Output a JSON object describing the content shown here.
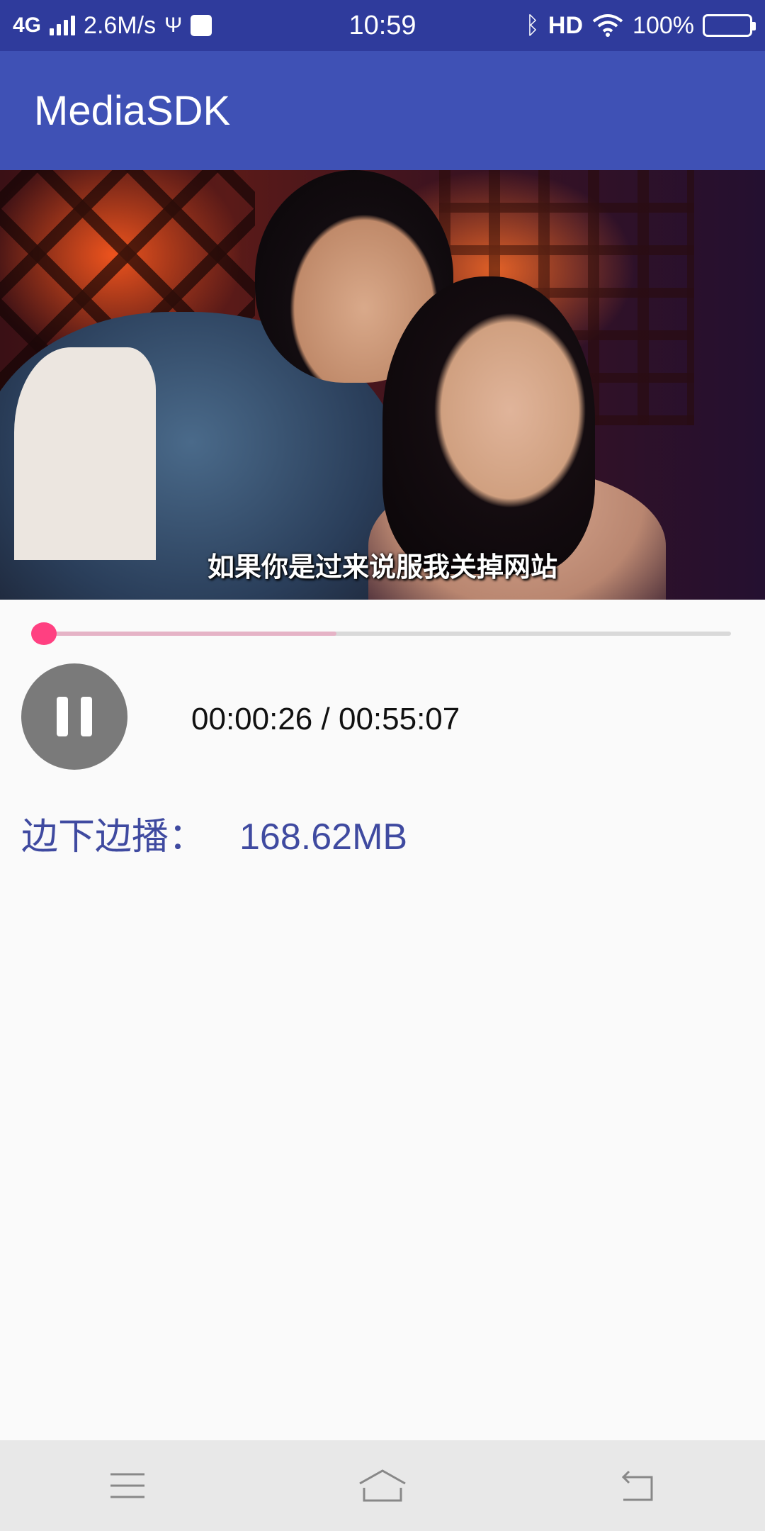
{
  "status_bar": {
    "network": "4G",
    "speed": "2.6M/s",
    "time": "10:59",
    "hd": "HD",
    "battery": "100%"
  },
  "app_bar": {
    "title": "MediaSDK"
  },
  "video": {
    "subtitle": "如果你是过来说服我关掉网站"
  },
  "player": {
    "progress_fraction": 0.008,
    "buffer_fraction": 0.43,
    "elapsed": "00:00:26",
    "separator": " / ",
    "duration": "00:55:07"
  },
  "download": {
    "label": "边下边播：",
    "size": "168.62MB"
  },
  "colors": {
    "status_bar": "#2f3b9c",
    "app_bar": "#3f51b5",
    "accent": "#ff4081",
    "download_text": "#3f4aa0"
  }
}
